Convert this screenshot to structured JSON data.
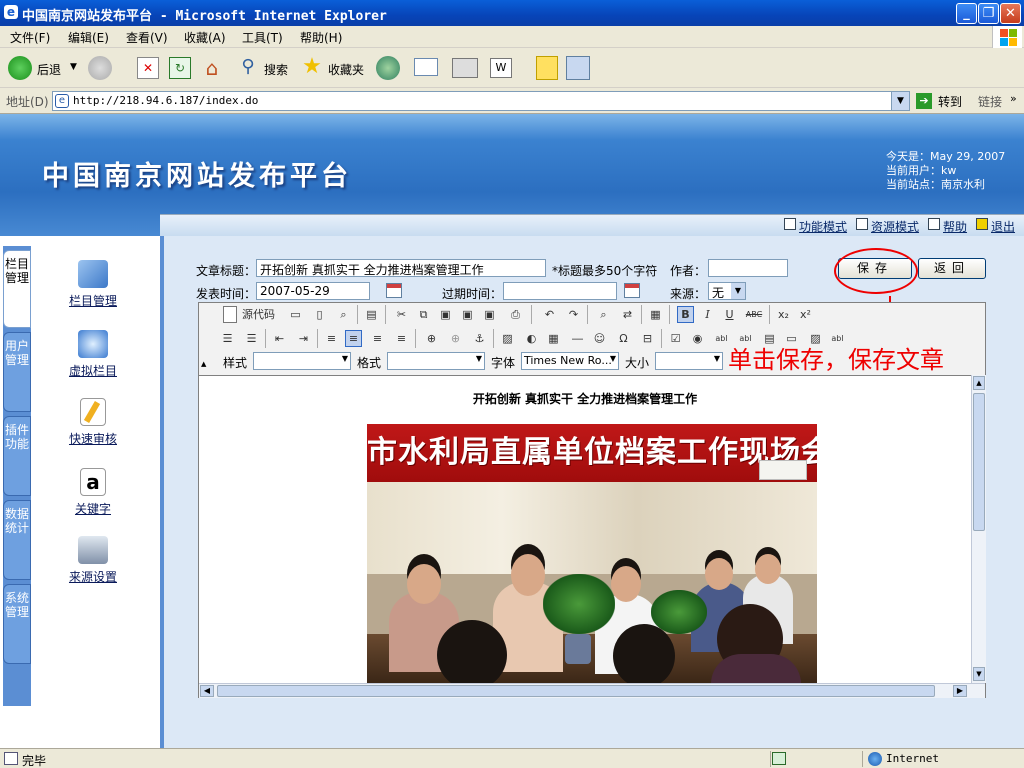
{
  "window": {
    "title": "中国南京网站发布平台 - Microsoft Internet Explorer",
    "controls": {
      "minimize": "_",
      "maximize": "❐",
      "close": "✕"
    }
  },
  "menu": [
    "文件(F)",
    "编辑(E)",
    "查看(V)",
    "收藏(A)",
    "工具(T)",
    "帮助(H)"
  ],
  "toolbar": {
    "back": "后退",
    "search": "搜索",
    "favorites": "收藏夹"
  },
  "address": {
    "label": "地址(D)",
    "url": "http://218.94.6.187/index.do",
    "go": "转到",
    "links": "链接"
  },
  "site": {
    "title": "中国南京网站发布平台",
    "today": "今天是：May 29, 2007",
    "current_user": "当前用户：kw",
    "current_site": "当前站点：南京水利",
    "nav": [
      "功能模式",
      "资源模式",
      "帮助",
      "退出"
    ]
  },
  "sidebar": {
    "tabs": [
      "栏目管理",
      "用户管理",
      "插件功能",
      "数据统计",
      "系统管理"
    ],
    "items": [
      "栏目管理",
      "虚拟栏目",
      "快速审核",
      "关键字",
      "来源设置"
    ]
  },
  "form": {
    "title_label": "文章标题：",
    "title_value": "开拓创新 真抓实干 全力推进档案管理工作",
    "title_hint": "*标题最多50个字符",
    "author_label": "作者：",
    "author_value": "",
    "publish_label": "发表时间：",
    "publish_value": "2007-05-29",
    "expire_label": "过期时间：",
    "expire_value": "",
    "source_label": "来源：",
    "source_value": "无",
    "save": "保存",
    "back": "返回"
  },
  "annotation": "单击保存，保存文章",
  "editor": {
    "source_code": "源代码",
    "style_label": "样式",
    "format_label": "格式",
    "font_label": "字体",
    "font_value": "Times New Ro...",
    "size_label": "大小",
    "content_title": "开拓创新 真抓实干 全力推进档案管理工作",
    "photo_banner": "市水利局直属单位档案工作现场会"
  },
  "status": {
    "text": "完毕",
    "zone": "Internet"
  }
}
